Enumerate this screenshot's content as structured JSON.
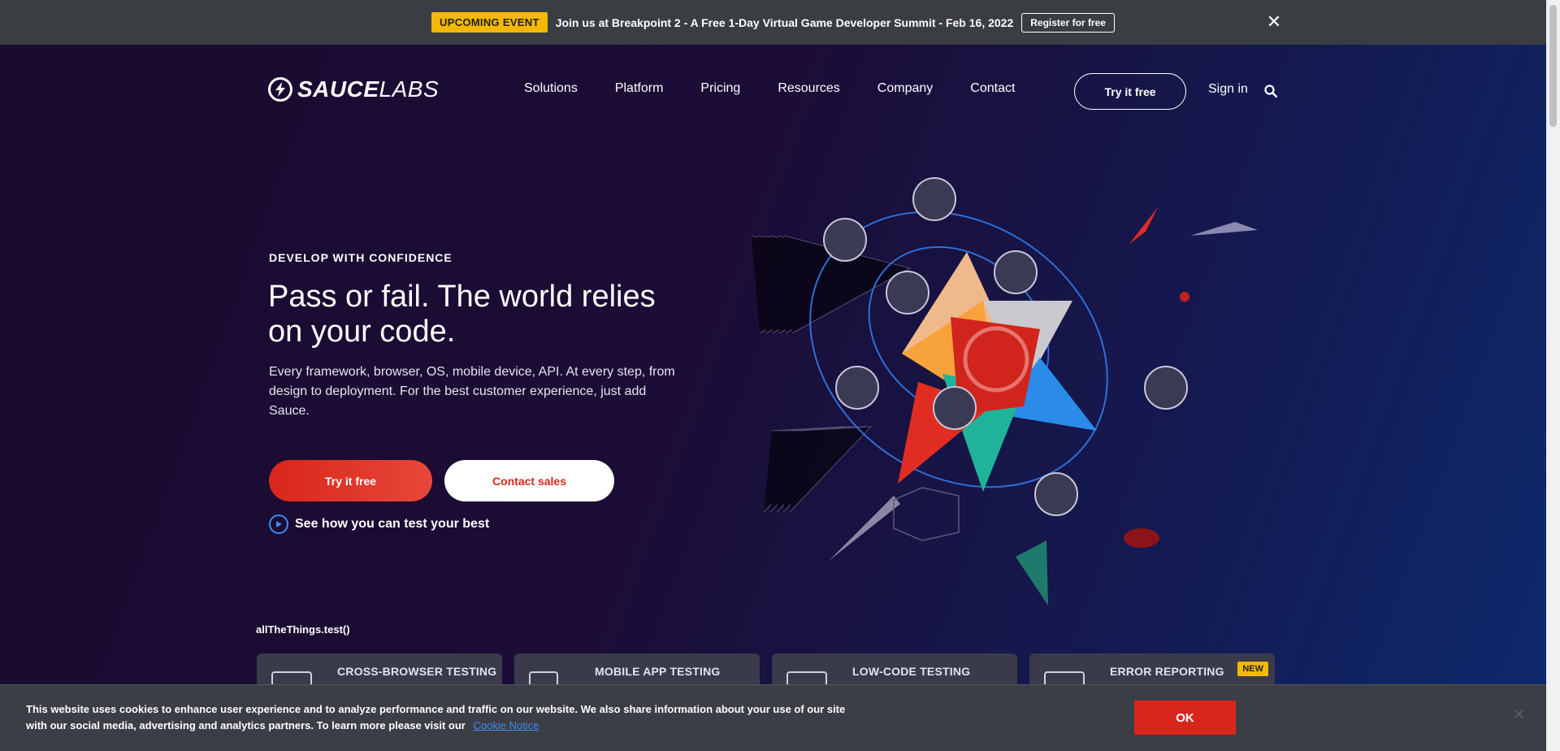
{
  "announcement": {
    "badge": "UPCOMING EVENT",
    "message": "Join us at Breakpoint 2 - A Free 1-Day Virtual Game Developer Summit - Feb 16, 2022",
    "cta": "Register for free",
    "close": "✕"
  },
  "brand": {
    "name_bold": "SAUCE",
    "name_light": "LABS"
  },
  "nav": {
    "items": [
      {
        "label": "Solutions"
      },
      {
        "label": "Platform"
      },
      {
        "label": "Pricing"
      },
      {
        "label": "Resources"
      },
      {
        "label": "Company"
      },
      {
        "label": "Contact"
      }
    ],
    "try_label": "Try it free",
    "signin_label": "Sign in"
  },
  "hero": {
    "eyebrow": "DEVELOP WITH CONFIDENCE",
    "headline": "Pass or fail. The world relies on your code.",
    "lede": "Every framework, browser, OS, mobile device, API. At every step, from design to deployment. For the best customer experience, just add Sauce.",
    "primary_cta": "Try it free",
    "secondary_cta": "Contact sales",
    "video_link": "See how you can test your best"
  },
  "things": {
    "label": "allTheThings.test()",
    "cards": [
      {
        "title": "CROSS-BROWSER TESTING",
        "badge": ""
      },
      {
        "title": "MOBILE APP TESTING",
        "badge": ""
      },
      {
        "title": "LOW-CODE TESTING",
        "badge": ""
      },
      {
        "title": "ERROR REPORTING",
        "badge": "NEW"
      }
    ]
  },
  "cookie": {
    "text": "This website uses cookies to enhance user experience and to analyze performance and traffic on our website. We also share information about your use of our site with our social media, advertising and analytics partners. To learn more please visit our",
    "link": "Cookie Notice",
    "ok": "OK",
    "close": "✕"
  },
  "colors": {
    "accent_red": "#d9261c",
    "badge_yellow": "#f5b800",
    "link_blue": "#3d8cf0"
  }
}
